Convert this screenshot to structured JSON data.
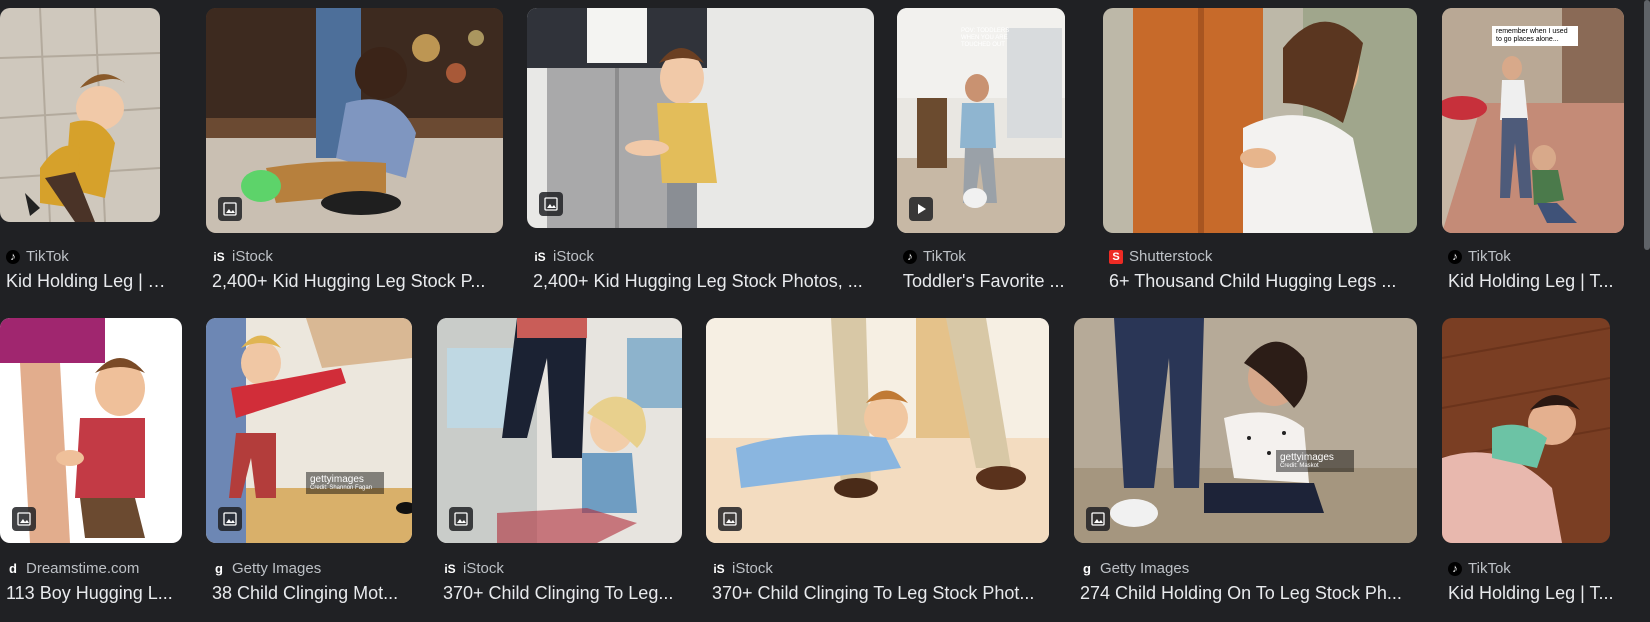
{
  "results": [
    {
      "source": "TikTok",
      "source_icon": "tiktok-icon",
      "title": "Kid Holding Leg | T...",
      "badge": "image-icon"
    },
    {
      "source": "iStock",
      "source_icon": "istock-icon",
      "title": "2,400+ Kid Hugging Leg Stock P...",
      "badge": "image-icon"
    },
    {
      "source": "iStock",
      "source_icon": "istock-icon",
      "title": "2,400+ Kid Hugging Leg Stock Photos, ...",
      "badge": "image-icon"
    },
    {
      "source": "TikTok",
      "source_icon": "tiktok-icon",
      "title": "Toddler's Favorite ...",
      "badge": "play-icon"
    },
    {
      "source": "Shutterstock",
      "source_icon": "shutterstock-icon",
      "title": "6+ Thousand Child Hugging Legs ...",
      "badge": ""
    },
    {
      "source": "TikTok",
      "source_icon": "tiktok-icon",
      "title": "Kid Holding Leg | T...",
      "badge": ""
    },
    {
      "source": "Dreamstime.com",
      "source_icon": "dreamstime-icon",
      "title": "113 Boy Hugging L...",
      "badge": "image-icon"
    },
    {
      "source": "Getty Images",
      "source_icon": "getty-icon",
      "title": "38 Child Clinging Mot...",
      "badge": "image-icon"
    },
    {
      "source": "iStock",
      "source_icon": "istock-icon",
      "title": "370+ Child Clinging To Leg...",
      "badge": "image-icon"
    },
    {
      "source": "iStock",
      "source_icon": "istock-icon",
      "title": "370+ Child Clinging To Leg Stock Phot...",
      "badge": "image-icon"
    },
    {
      "source": "Getty Images",
      "source_icon": "getty-icon",
      "title": "274 Child Holding On To Leg Stock Ph...",
      "badge": "image-icon"
    },
    {
      "source": "TikTok",
      "source_icon": "tiktok-icon",
      "title": "Kid Holding Leg | T...",
      "badge": ""
    }
  ],
  "overlays": {
    "tiktok_caption_1": "POV: TODDLERS WHEN YOU ARE TOUCHED OUT",
    "tiktok_caption_2": "remember when I used to go places alone...",
    "getty_wm": "gettyimages",
    "getty_credit_1": "Credit: Shannon Fagan",
    "getty_credit_2": "Credit: Maskot"
  }
}
